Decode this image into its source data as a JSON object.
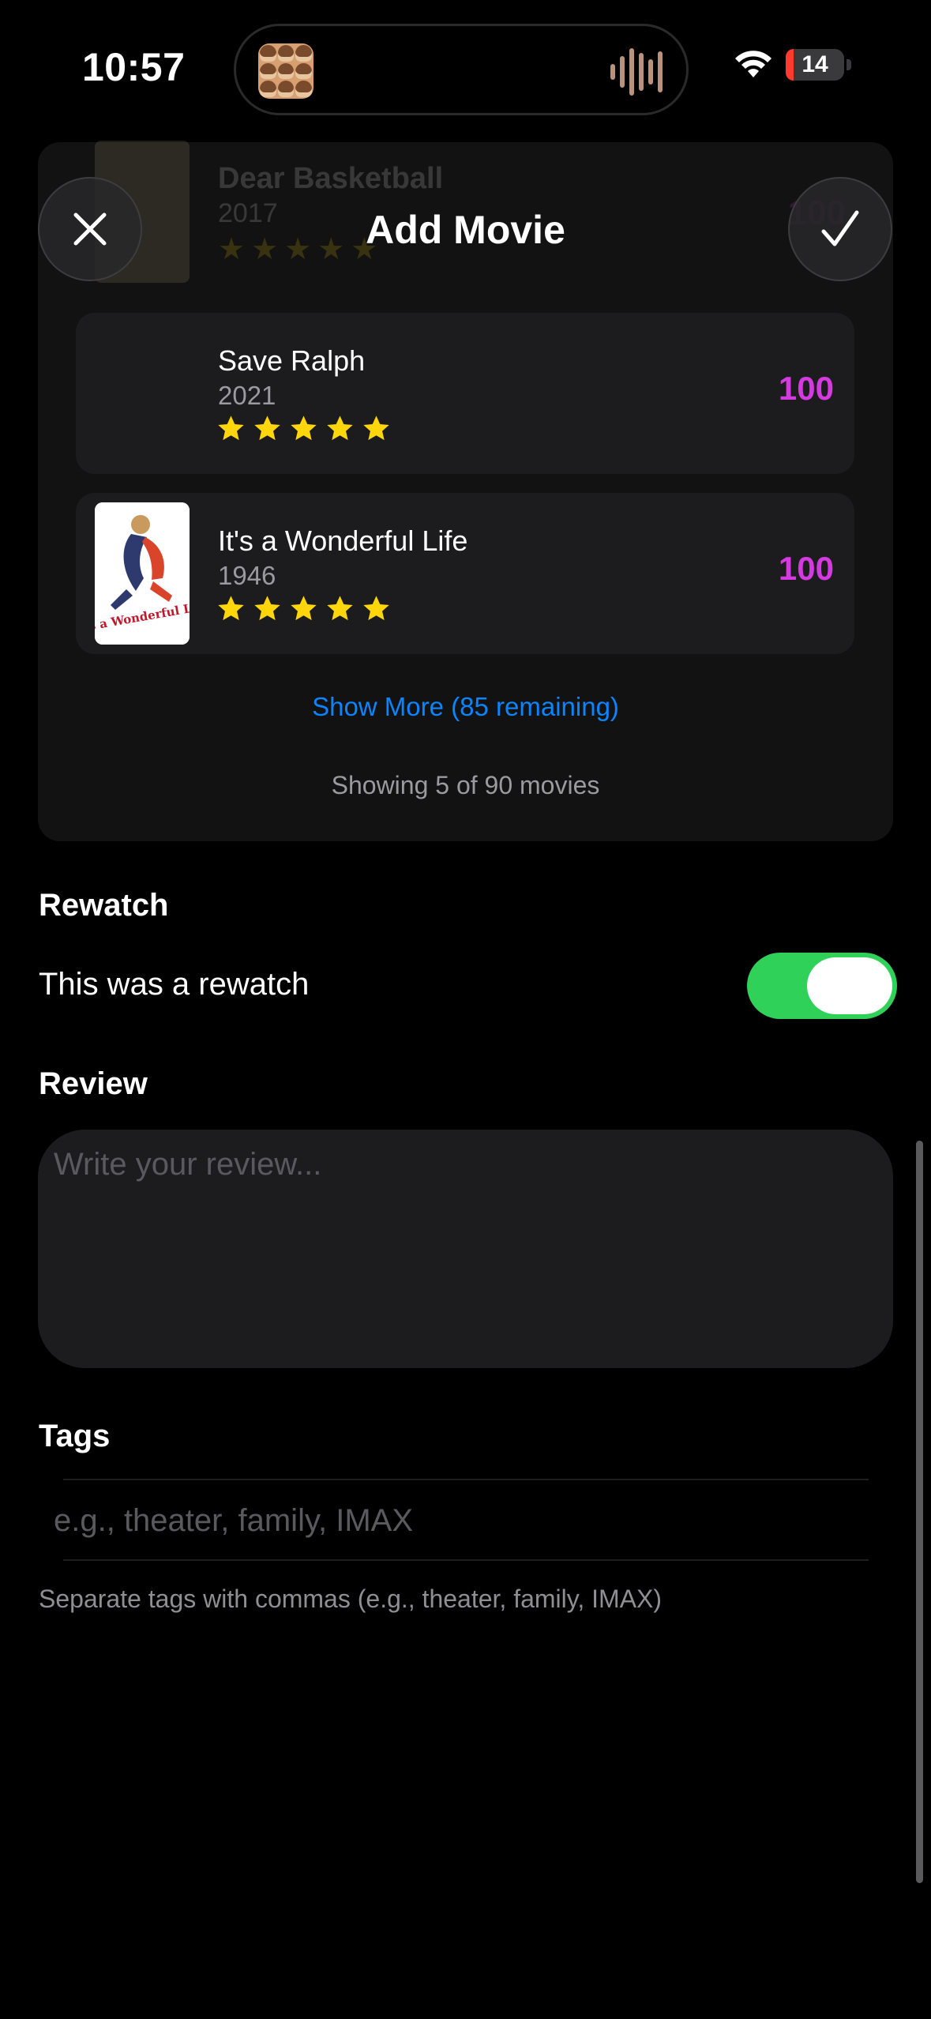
{
  "status_bar": {
    "time": "10:57",
    "battery_percent": "14",
    "battery_level": 0.14,
    "battery_color": "#ff3b30"
  },
  "header": {
    "title": "Add Movie",
    "close_icon": "xmark-icon",
    "done_icon": "checkmark-icon"
  },
  "movie_list": {
    "partial_item": {
      "title": "Dear Basketball",
      "year": "2017",
      "score": "100",
      "rating_stars": 5
    },
    "items": [
      {
        "title": "Save Ralph",
        "year": "2021",
        "score": "100",
        "rating_stars": 5,
        "poster": "none"
      },
      {
        "title": "It's a Wonderful Life",
        "year": "1946",
        "score": "100",
        "rating_stars": 5,
        "poster_text": "It's a Wonderful Life"
      }
    ],
    "show_more_label": "Show More (85 remaining)",
    "showing_count": "Showing 5 of 90 movies",
    "score_color": "#d53ae0",
    "star_color": "#ffd60a",
    "link_color": "#0a84ff"
  },
  "rewatch": {
    "section_label": "Rewatch",
    "toggle_label": "This was a rewatch",
    "toggle_on": true,
    "toggle_color": "#30d158"
  },
  "review": {
    "section_label": "Review",
    "placeholder": "Write your review...",
    "value": ""
  },
  "tags": {
    "section_label": "Tags",
    "placeholder": "e.g., theater, family, IMAX",
    "value": "",
    "hint": "Separate tags with commas (e.g., theater, family, IMAX)"
  }
}
